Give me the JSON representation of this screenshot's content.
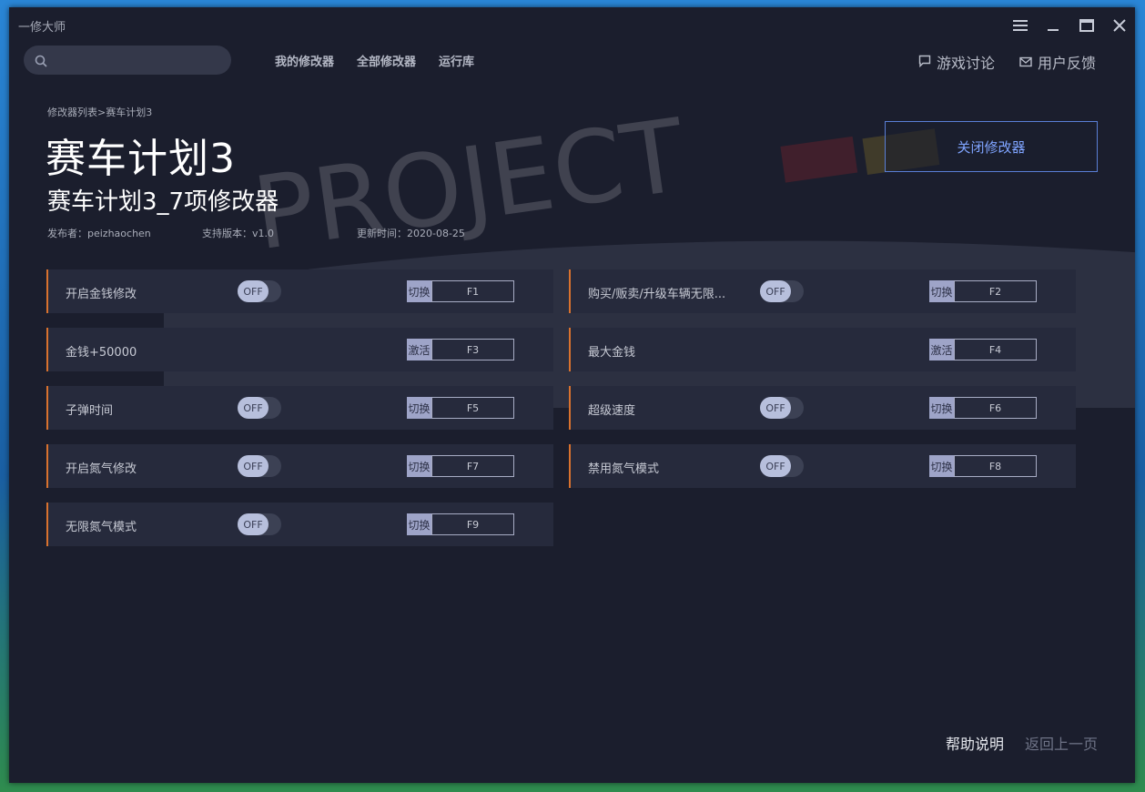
{
  "app": {
    "title": "一修大师"
  },
  "search": {
    "placeholder": ""
  },
  "nav": {
    "my_trainers": "我的修改器",
    "all_trainers": "全部修改器",
    "runtime": "运行库"
  },
  "top_right": {
    "discussion": "游戏讨论",
    "feedback": "用户反馈"
  },
  "breadcrumb": {
    "list": "修改器列表",
    "sep": ">",
    "current": "赛车计划3"
  },
  "game": {
    "title": "赛车计划3",
    "trainer_title": "赛车计划3_7项修改器",
    "publisher": "发布者：peizhaochen",
    "version": "支持版本：v1.0",
    "updated": "更新时间：2020-08-25"
  },
  "close_button": {
    "label": "关闭修改器"
  },
  "cheats": [
    {
      "label": "开启金钱修改",
      "toggle": "OFF",
      "action": "切换",
      "key": "F1"
    },
    {
      "label": "购买/贩卖/升级车辆无限...",
      "toggle": "OFF",
      "action": "切换",
      "key": "F2"
    },
    {
      "label": "金钱+50000",
      "toggle": "",
      "action": "激活",
      "key": "F3"
    },
    {
      "label": "最大金钱",
      "toggle": "",
      "action": "激活",
      "key": "F4"
    },
    {
      "label": "子弹时间",
      "toggle": "OFF",
      "action": "切换",
      "key": "F5"
    },
    {
      "label": "超级速度",
      "toggle": "OFF",
      "action": "切换",
      "key": "F6"
    },
    {
      "label": "开启氮气修改",
      "toggle": "OFF",
      "action": "切换",
      "key": "F7"
    },
    {
      "label": "禁用氮气模式",
      "toggle": "OFF",
      "action": "切换",
      "key": "F8"
    },
    {
      "label": "无限氮气模式",
      "toggle": "OFF",
      "action": "切换",
      "key": "F9"
    }
  ],
  "footer": {
    "help": "帮助说明",
    "back": "返回上一页"
  },
  "background_text": "PROJECT",
  "colors": {
    "accent_border": "#d9722e",
    "window_bg": "#1b1e2d",
    "row_bg": "#262a3c",
    "close_btn": "#7fa4ff"
  }
}
